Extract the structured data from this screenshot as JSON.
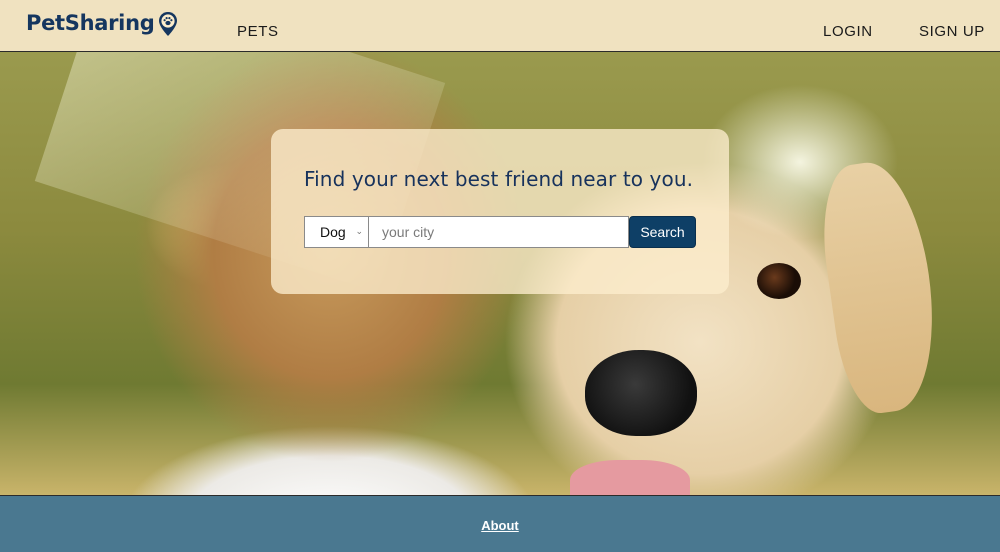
{
  "header": {
    "logo_text": "PetSharing",
    "logo_icon": "paw-pin-icon",
    "nav": {
      "pets": "PETS",
      "login": "LOGIN",
      "signup": "SIGN UP"
    }
  },
  "search_card": {
    "title": "Find your next best friend near to you.",
    "pet_type_selected": "Dog",
    "city_placeholder": "your city",
    "city_value": "",
    "search_label": "Search"
  },
  "footer": {
    "about_label": "About"
  },
  "colors": {
    "brand": "#15365f",
    "button": "#0e3f66",
    "footer_bg": "#4a7890",
    "header_bg": "#fcedcc"
  }
}
